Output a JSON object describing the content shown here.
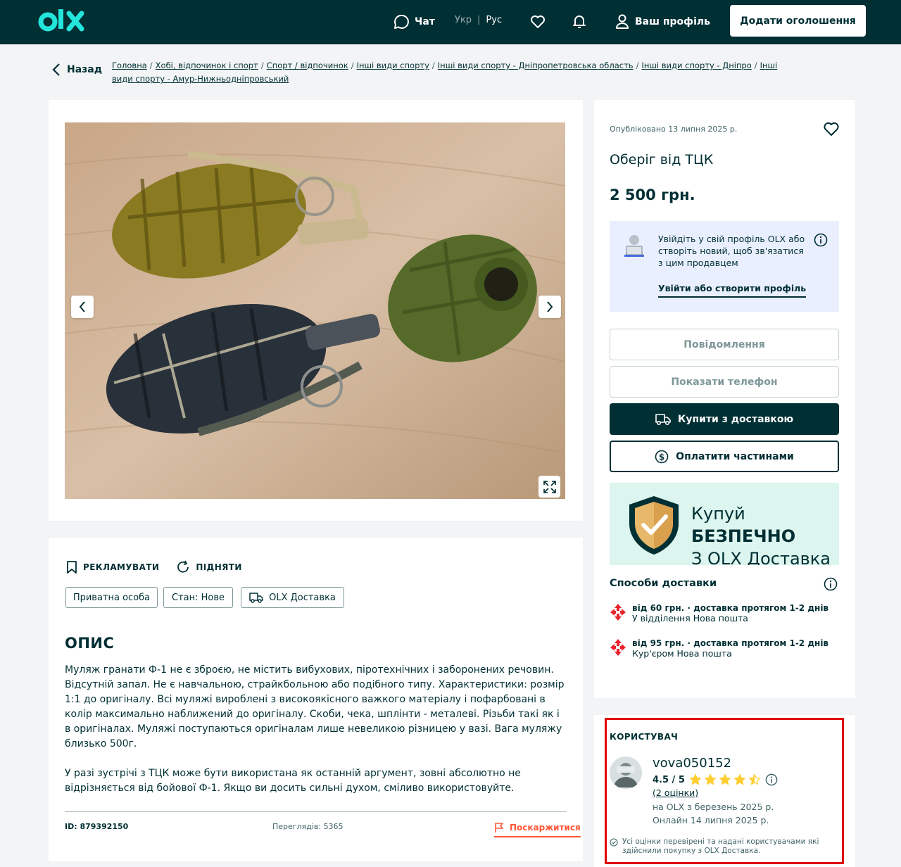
{
  "header": {
    "logo_text": "olx",
    "chat_label": "Чат",
    "lang_ukr": "Укр",
    "lang_sep": "|",
    "lang_rus": "Рус",
    "profile_label": "Ваш профіль",
    "post_button": "Додати оголошення"
  },
  "breadcrumb": {
    "back_label": "Назад",
    "items": [
      "Головна",
      "Хобі, відпочинок і спорт",
      "Спорт / відпочинок",
      "Інші види спорту",
      "Інші види спорту - Дніпропетровська область",
      "Інші види спорту - Дніпро",
      "Інші види спорту - Амур-Нижньодніпровський"
    ]
  },
  "listing": {
    "published": "Опубліковано 13 липня 2025 р.",
    "title": "Оберіг від ТЦК",
    "price": "2 500 грн.",
    "actions": {
      "advertise": "РЕКЛАМУВАТИ",
      "raise": "ПІДНЯТИ"
    },
    "tags": [
      "Приватна особа",
      "Стан: Нове",
      "OLX Доставка"
    ],
    "description_title": "ОПИС",
    "description": [
      "Муляж гранати Ф-1 не є зброєю, не містить вибухових, піротехнічних і заборонених речовин. Відсутній запал. Не є навчальною, страйкбольною або подібного типу. Характеристики: розмір 1:1 до оригіналу. Всі муляжі вироблені з високоякісного важкого матеріалу і пофарбовані в колір максимально наближений до оригіналу. Скоби, чека, шплінти - металеві. Різьби такі як і в оригіналах. Муляжі поступаються оригіналам лише невеликою різницею у вазі. Вага муляжу близько 500г.",
      "У разі зустрічі з ТЦК може бути використана як останній аргумент, зовні абсолютно не відрізняється від бойової Ф-1. Якщо ви досить сильні духом, сміливо використовуйте."
    ],
    "id": "ID: 879392150",
    "views": "Переглядів: 5365",
    "report": "Поскаржитися"
  },
  "contact": {
    "login_prompt": "Увійдіть у свій профіль OLX або створіть новий, щоб зв'язатися з цим продавцем",
    "login_link": "Увійти або створити профіль",
    "message_button": "Повідомлення",
    "phone_button": "Показати телефон",
    "buy_button": "Купити з доставкою",
    "installments_button": "Оплатити частинами"
  },
  "banner": {
    "line1_a": "Купуй ",
    "line1_b": "БЕЗПЕЧНО",
    "line2": "З OLX Доставка"
  },
  "shipping": {
    "title": "Способи доставки",
    "options": [
      {
        "line1": "від 60 грн. · доставка протягом 1-2 днів",
        "line2": "У відділення Нова пошта"
      },
      {
        "line1": "від 95 грн. · доставка протягом 1-2 днів",
        "line2": "Кур'єром Нова пошта"
      }
    ]
  },
  "seller": {
    "heading": "КОРИСТУВАЧ",
    "name": "vova050152",
    "rating_text": "4.5 / 5",
    "rating_value": 4.5,
    "rating_max": 5,
    "reviews": "(2 оцінки)",
    "since": "на OLX з березень 2025 р.",
    "online": "Онлайн 14 липня 2025 р.",
    "verified_note": "Усі оцінки перевірені та надані користувачами які здійснили покупку з OLX Доставка."
  },
  "colors": {
    "header_bg": "#002f34",
    "accent_teal": "#23e5db",
    "star": "#ffce32",
    "report": "#ff5636",
    "highlight_border": "#e00000",
    "login_box_bg": "#e9efff",
    "banner_bg": "#dcf5ee"
  }
}
